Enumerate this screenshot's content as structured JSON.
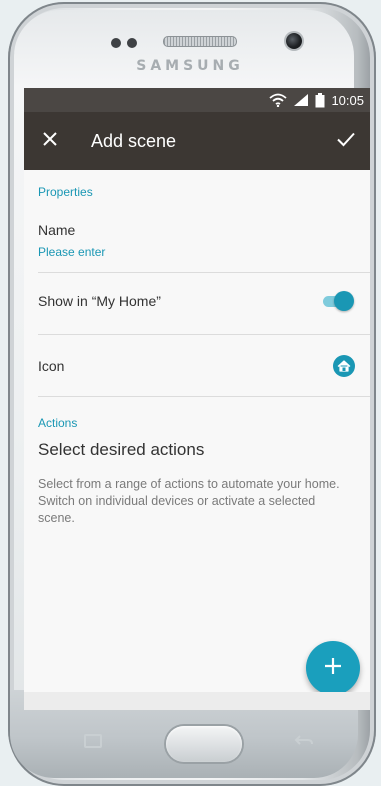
{
  "device": {
    "brand": "SAMSUNG"
  },
  "status_bar": {
    "time": "10:05",
    "icons": [
      "wifi-icon",
      "signal-icon",
      "battery-icon"
    ]
  },
  "app_bar": {
    "title": "Add scene",
    "close_icon": "close-icon",
    "confirm_icon": "check-icon",
    "background": "#3c3733"
  },
  "properties": {
    "heading": "Properties",
    "name_label": "Name",
    "name_placeholder": "Please enter",
    "show_in_home_label": "Show in “My Home”",
    "show_in_home_enabled": true,
    "icon_label": "Icon",
    "icon_value": "home-icon"
  },
  "actions": {
    "heading": "Actions",
    "title": "Select desired actions",
    "description": "Select from a range of actions to automate your home. Switch on individual devices or activate a selected scene."
  },
  "fab": {
    "icon": "plus-icon"
  },
  "colors": {
    "accent": "#1a97b4",
    "fab": "#1a9fbd",
    "status_bar": "#4b4744"
  }
}
